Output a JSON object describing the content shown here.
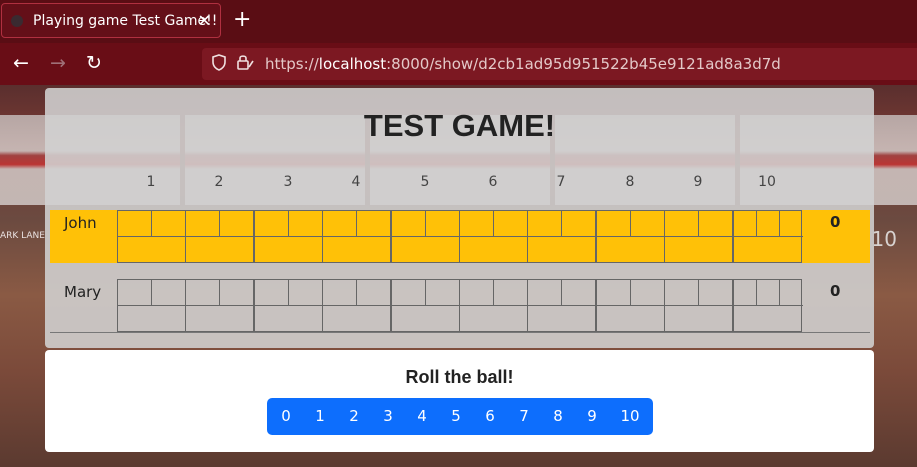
{
  "browser": {
    "tab_title": "Playing game Test Game!!",
    "tab_close": "✕",
    "new_tab": "+",
    "url_scheme": "https://",
    "url_host": "localhost",
    "url_rest": ":8000/show/d2cb1ad95d951522b45e9121ad8a3d7d",
    "back": "←",
    "forward": "→",
    "reload": "↻"
  },
  "background": {
    "sign_text": "ARK LANE",
    "lane_number": "10"
  },
  "scoreboard": {
    "title": "TEST GAME!",
    "frames": [
      "1",
      "2",
      "3",
      "4",
      "5",
      "6",
      "7",
      "8",
      "9",
      "10"
    ],
    "players": [
      {
        "name": "John",
        "total": "0",
        "active": true
      },
      {
        "name": "Mary",
        "total": "0",
        "active": false
      }
    ]
  },
  "roll": {
    "title": "Roll the ball!",
    "buttons": [
      "0",
      "1",
      "2",
      "3",
      "4",
      "5",
      "6",
      "7",
      "8",
      "9",
      "10"
    ],
    "button_color": "#0d6efd"
  },
  "colors": {
    "active_row": "#ffc107",
    "chrome": "#5a0d14"
  }
}
